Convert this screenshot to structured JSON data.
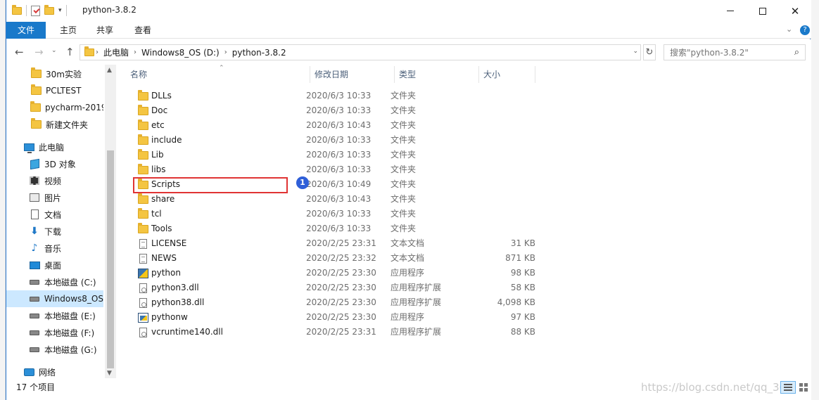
{
  "window": {
    "title": "python-3.8.2"
  },
  "ribbon": {
    "tabs": [
      "文件",
      "主页",
      "共享",
      "查看"
    ]
  },
  "address": {
    "crumbs": [
      "此电脑",
      "Windows8_OS (D:)",
      "python-3.8.2"
    ]
  },
  "search": {
    "placeholder": "搜索\"python-3.8.2\""
  },
  "nav_pane": {
    "items": [
      {
        "label": "30m实验",
        "icon": "folder-icon"
      },
      {
        "label": "PCLTEST",
        "icon": "folder-icon"
      },
      {
        "label": "pycharm-2019.",
        "icon": "folder-icon"
      },
      {
        "label": "新建文件夹",
        "icon": "folder-icon"
      },
      {
        "label": "此电脑",
        "icon": "computer-icon"
      },
      {
        "label": "3D 对象",
        "icon": "3d-objects-icon"
      },
      {
        "label": "视频",
        "icon": "video-icon"
      },
      {
        "label": "图片",
        "icon": "picture-icon"
      },
      {
        "label": "文档",
        "icon": "document-icon"
      },
      {
        "label": "下载",
        "icon": "download-icon"
      },
      {
        "label": "音乐",
        "icon": "music-icon"
      },
      {
        "label": "桌面",
        "icon": "desktop-icon"
      },
      {
        "label": "本地磁盘 (C:)",
        "icon": "drive-icon"
      },
      {
        "label": "Windows8_OS",
        "icon": "drive-icon",
        "selected": true
      },
      {
        "label": "本地磁盘 (E:)",
        "icon": "drive-icon"
      },
      {
        "label": "本地磁盘 (F:)",
        "icon": "drive-icon"
      },
      {
        "label": "本地磁盘 (G:)",
        "icon": "drive-icon"
      },
      {
        "label": "网络",
        "icon": "network-icon"
      }
    ]
  },
  "columns": {
    "name": "名称",
    "date": "修改日期",
    "type": "类型",
    "size": "大小"
  },
  "files": [
    {
      "name": "DLLs",
      "date": "2020/6/3 10:33",
      "type": "文件夹",
      "size": "",
      "icon": "folder"
    },
    {
      "name": "Doc",
      "date": "2020/6/3 10:33",
      "type": "文件夹",
      "size": "",
      "icon": "folder"
    },
    {
      "name": "etc",
      "date": "2020/6/3 10:43",
      "type": "文件夹",
      "size": "",
      "icon": "folder"
    },
    {
      "name": "include",
      "date": "2020/6/3 10:33",
      "type": "文件夹",
      "size": "",
      "icon": "folder"
    },
    {
      "name": "Lib",
      "date": "2020/6/3 10:33",
      "type": "文件夹",
      "size": "",
      "icon": "folder"
    },
    {
      "name": "libs",
      "date": "2020/6/3 10:33",
      "type": "文件夹",
      "size": "",
      "icon": "folder"
    },
    {
      "name": "Scripts",
      "date": "2020/6/3 10:49",
      "type": "文件夹",
      "size": "",
      "icon": "folder"
    },
    {
      "name": "share",
      "date": "2020/6/3 10:43",
      "type": "文件夹",
      "size": "",
      "icon": "folder"
    },
    {
      "name": "tcl",
      "date": "2020/6/3 10:33",
      "type": "文件夹",
      "size": "",
      "icon": "folder"
    },
    {
      "name": "Tools",
      "date": "2020/6/3 10:33",
      "type": "文件夹",
      "size": "",
      "icon": "folder"
    },
    {
      "name": "LICENSE",
      "date": "2020/2/25 23:31",
      "type": "文本文档",
      "size": "31 KB",
      "icon": "text"
    },
    {
      "name": "NEWS",
      "date": "2020/2/25 23:32",
      "type": "文本文档",
      "size": "871 KB",
      "icon": "text"
    },
    {
      "name": "python",
      "date": "2020/2/25 23:30",
      "type": "应用程序",
      "size": "98 KB",
      "icon": "exe"
    },
    {
      "name": "python3.dll",
      "date": "2020/2/25 23:30",
      "type": "应用程序扩展",
      "size": "58 KB",
      "icon": "dll"
    },
    {
      "name": "python38.dll",
      "date": "2020/2/25 23:30",
      "type": "应用程序扩展",
      "size": "4,098 KB",
      "icon": "dll"
    },
    {
      "name": "pythonw",
      "date": "2020/2/25 23:30",
      "type": "应用程序",
      "size": "97 KB",
      "icon": "exew"
    },
    {
      "name": "vcruntime140.dll",
      "date": "2020/2/25 23:31",
      "type": "应用程序扩展",
      "size": "88 KB",
      "icon": "dll"
    }
  ],
  "annotation": {
    "callout_number": "1"
  },
  "status": {
    "item_count": "17 个项目",
    "watermark": "https://blog.csdn.net/qq_366"
  },
  "colors": {
    "accent": "#1979ca",
    "selection": "#cce8ff",
    "highlight_box": "#e03434",
    "callout": "#2f5fd8"
  }
}
